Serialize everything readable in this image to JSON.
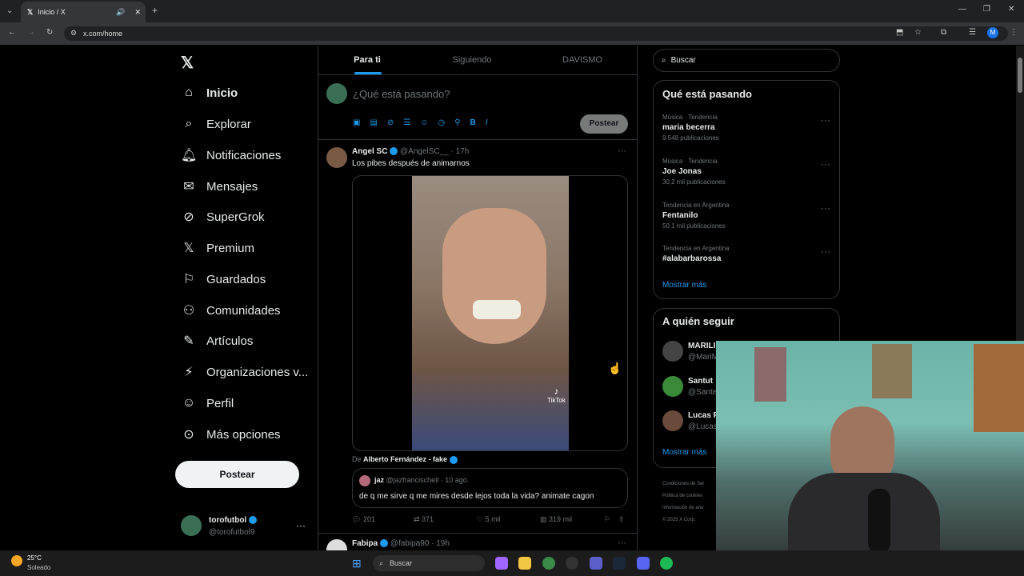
{
  "browser": {
    "tab_title": "Inicio / X",
    "url": "x.com/home",
    "profile_initial": "M"
  },
  "sidebar": {
    "items": [
      {
        "label": "Inicio",
        "icon": "home-icon"
      },
      {
        "label": "Explorar",
        "icon": "search-icon"
      },
      {
        "label": "Notificaciones",
        "icon": "bell-icon"
      },
      {
        "label": "Mensajes",
        "icon": "mail-icon"
      },
      {
        "label": "SuperGrok",
        "icon": "grok-icon"
      },
      {
        "label": "Premium",
        "icon": "x-icon"
      },
      {
        "label": "Guardados",
        "icon": "bookmark-icon"
      },
      {
        "label": "Comunidades",
        "icon": "people-icon"
      },
      {
        "label": "Artículos",
        "icon": "article-icon"
      },
      {
        "label": "Organizaciones v...",
        "icon": "bolt-icon"
      },
      {
        "label": "Perfil",
        "icon": "person-icon"
      },
      {
        "label": "Más opciones",
        "icon": "more-circle-icon"
      }
    ],
    "post_button": "Postear",
    "account": {
      "name": "torofutbol",
      "handle": "@torofutbol9"
    }
  },
  "feed": {
    "tabs": [
      "Para ti",
      "Siguiendo",
      "DAVISMO"
    ],
    "composer": {
      "placeholder": "¿Qué está pasando?",
      "post_button": "Postear"
    },
    "tweet": {
      "author": "Angel SC",
      "handle": "@AngelSC__",
      "time": "· 17h",
      "text": "Los pibes después de animarnos",
      "source_prefix": "De",
      "source_name": "Alberto Fernández - fake",
      "tiktok_label": "TikTok",
      "quote": {
        "author": "jaz",
        "handle": "@jazfrancischell",
        "time": "· 10 ago.",
        "text": "de q me sirve q me mires desde lejos toda la vida? animate cagon"
      },
      "stats": {
        "replies": "201",
        "retweets": "371",
        "likes": "5 mil",
        "views": "319 mil"
      }
    },
    "next_tweet": {
      "author": "Fabipa",
      "handle": "@fabipa90",
      "time": "· 19h"
    }
  },
  "right": {
    "search_placeholder": "Buscar",
    "trends_title": "Qué está pasando",
    "trends": [
      {
        "category": "Música · Tendencia",
        "name": "maria becerra",
        "count": "9.548 publicaciones"
      },
      {
        "category": "Música · Tendencia",
        "name": "Joe Jonas",
        "count": "30,2 mil publicaciones"
      },
      {
        "category": "Tendencia en Argentina",
        "name": "Fentanilo",
        "count": "50,1 mil publicaciones"
      },
      {
        "category": "Tendencia en Argentina",
        "name": "#alabarbarossa",
        "count": ""
      }
    ],
    "show_more": "Mostrar más",
    "follow_title": "A quién seguir",
    "follow": [
      {
        "name": "MARILI",
        "handle": "@MariM"
      },
      {
        "name": "Santut",
        "handle": "@Sante"
      },
      {
        "name": "Lucas R",
        "handle": "@Lucas"
      }
    ],
    "footer": [
      "Condiciones de Ser",
      "Política de cookies",
      "Información de anu",
      "© 2025 X Corp."
    ]
  },
  "taskbar": {
    "temp": "25°C",
    "weather": "Soleado",
    "search": "Buscar"
  }
}
